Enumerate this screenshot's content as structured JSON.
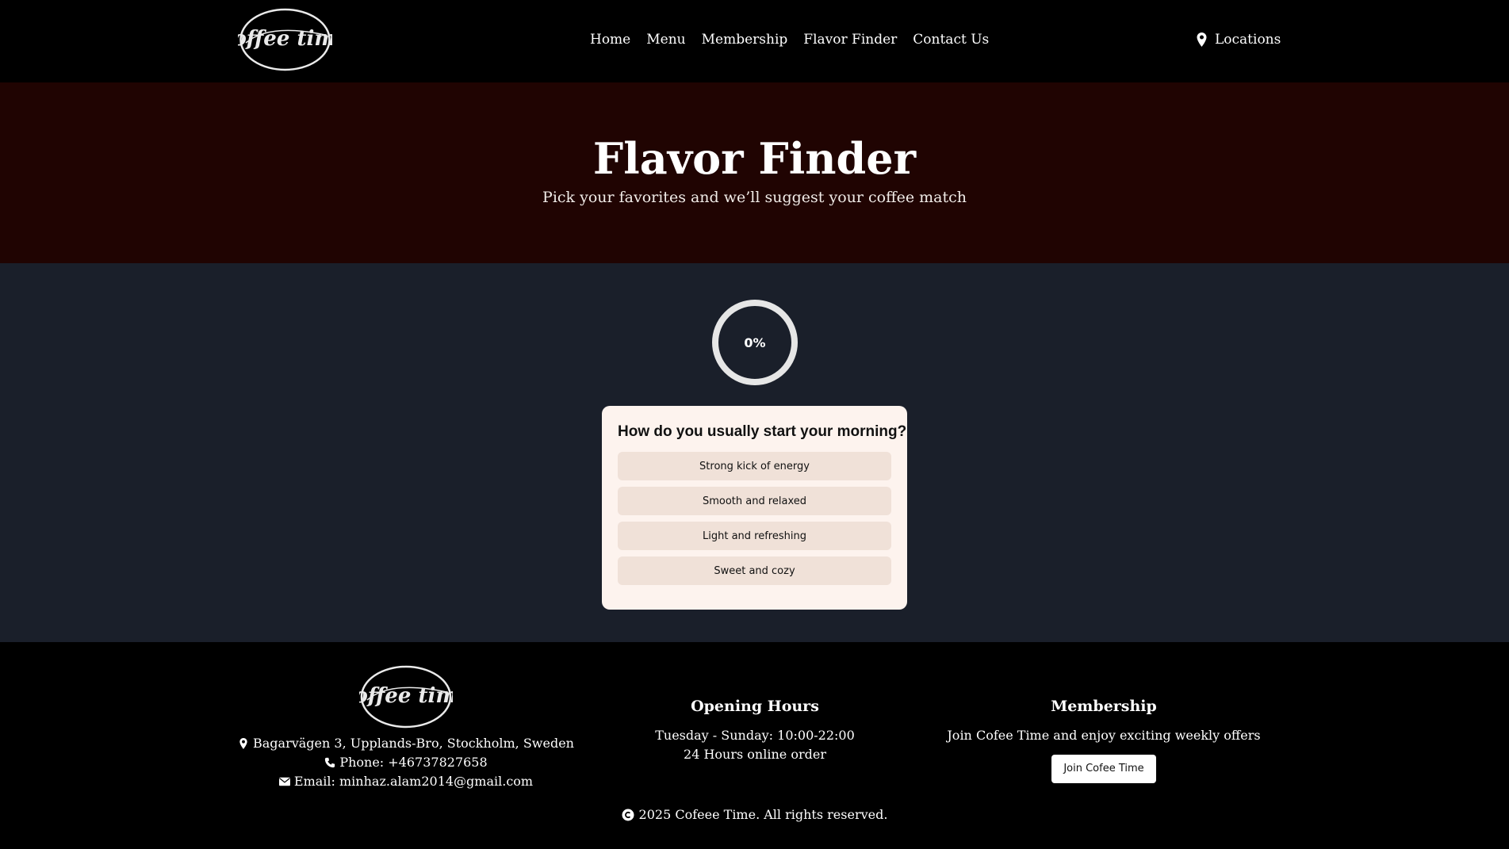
{
  "nav": {
    "logo_text": "coffee time",
    "links": [
      "Home",
      "Menu",
      "Membership",
      "Flavor Finder",
      "Contact Us"
    ],
    "locations": "Locations",
    "locations_icon": "map-pin-icon"
  },
  "hero": {
    "title": "Flavor Finder",
    "subtitle": "Pick your favorites and we’ll suggest your coffee match"
  },
  "progress": {
    "label": "0%",
    "value": 0
  },
  "quiz": {
    "question": "How do you usually start your morning?",
    "options": [
      "Strong kick of energy",
      "Smooth and relaxed",
      "Light and refreshing",
      "Sweet and cozy"
    ]
  },
  "footer": {
    "logo_text": "coffee time",
    "address": "Bagarvägen 3, Upplands-Bro, Stockholm, Sweden",
    "phone": "Phone: +46737827658",
    "email": "Email: minhaz.alam2014@gmail.com",
    "hours_title": "Opening Hours",
    "hours_line1": "Tuesday - Sunday: 10:00-22:00",
    "hours_line2": "24 Hours online order",
    "membership_title": "Membership",
    "membership_text": "Join Cofee Time and enjoy exciting weekly offers",
    "join_button": "Join Cofee Time",
    "copyright": "2025 Cofeee Time. All rights reserved."
  },
  "colors": {
    "navbar_bg": "#000000",
    "hero_bg": "#200402",
    "main_bg": "#1a1f2a",
    "card_bg": "#fdf3ee",
    "option_bg": "#f0e1d8"
  }
}
